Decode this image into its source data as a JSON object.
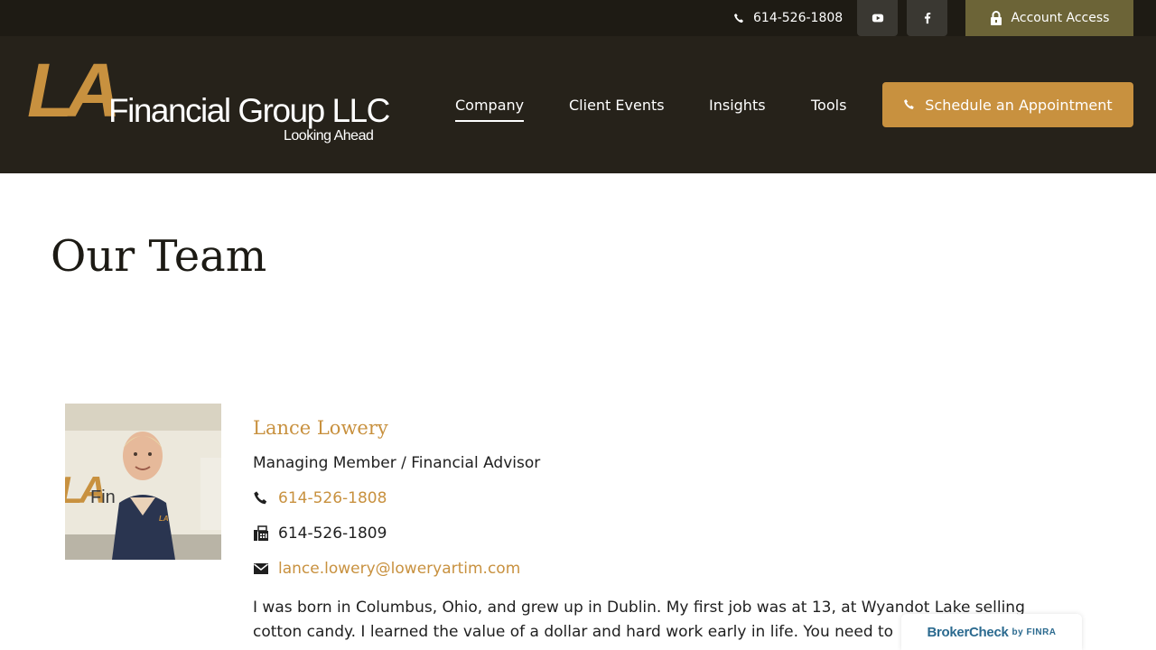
{
  "topbar": {
    "phone": "614-526-1808",
    "account_access": "Account Access",
    "social": [
      "youtube-icon",
      "facebook-icon"
    ]
  },
  "header": {
    "logo": {
      "letters": "LA",
      "name": "Financial Group LLC",
      "tagline": "Looking Ahead"
    },
    "nav": {
      "company": "Company",
      "client_events": "Client Events",
      "insights": "Insights",
      "tools": "Tools"
    },
    "schedule_button": "Schedule an Appointment"
  },
  "page": {
    "title": "Our Team"
  },
  "member": {
    "name": "Lance Lowery",
    "role": "Managing Member / Financial Advisor",
    "phone": "614-526-1808",
    "fax": "614-526-1809",
    "email": "lance.lowery@loweryartim.com",
    "bio": "I was born in Columbus, Ohio, and grew up in Dublin. My first job was at 13, at Wyandot Lake selling cotton candy. I learned the value of a dollar and hard work early in life. You need to"
  },
  "badge": {
    "text": "BrokerCheck",
    "by": "by FINRA"
  },
  "colors": {
    "accent": "#c8913f",
    "header_bg": "#26221a",
    "topbar_bg": "#1e1b14",
    "account_bg": "#6c6437"
  }
}
